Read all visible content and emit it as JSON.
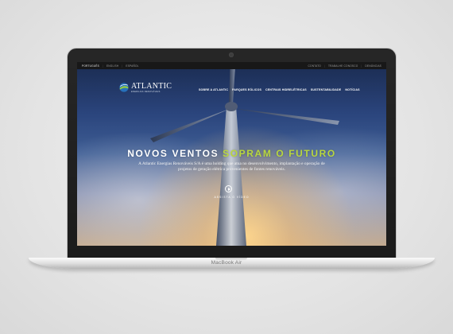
{
  "topbar": {
    "languages": [
      "PORTUGUÊS",
      "ENGLISH",
      "ESPAÑOL"
    ],
    "links": [
      "CONTATO",
      "TRABALHE CONOSCO",
      "DENÚNCIAS"
    ]
  },
  "logo": {
    "name": "ATLANTIC",
    "sub": "ENERGIAS RENOVÁVEIS"
  },
  "nav": [
    "SOBRE A ATLANTIC",
    "PARQUES EÓLICOS",
    "CENTRAIS HIDRELÉTRICAS",
    "SUSTENTABILIDADE",
    "NOTÍCIAS"
  ],
  "hero": {
    "headline_a": "NOVOS VENTOS",
    "headline_b": "SOPRAM O FUTURO",
    "description": "A Atlantic Energias Renováveis S/A é uma holding que atua no desenvolvimento, implantação e operação de projetos de geração elétrica provenientes de fontes renováveis.",
    "watch_label": "ASSISTA O VÍDEO"
  },
  "device": {
    "brand": "MacBook Air"
  },
  "colors": {
    "accent": "#b7d63a",
    "topbar": "#0d0d0d"
  }
}
